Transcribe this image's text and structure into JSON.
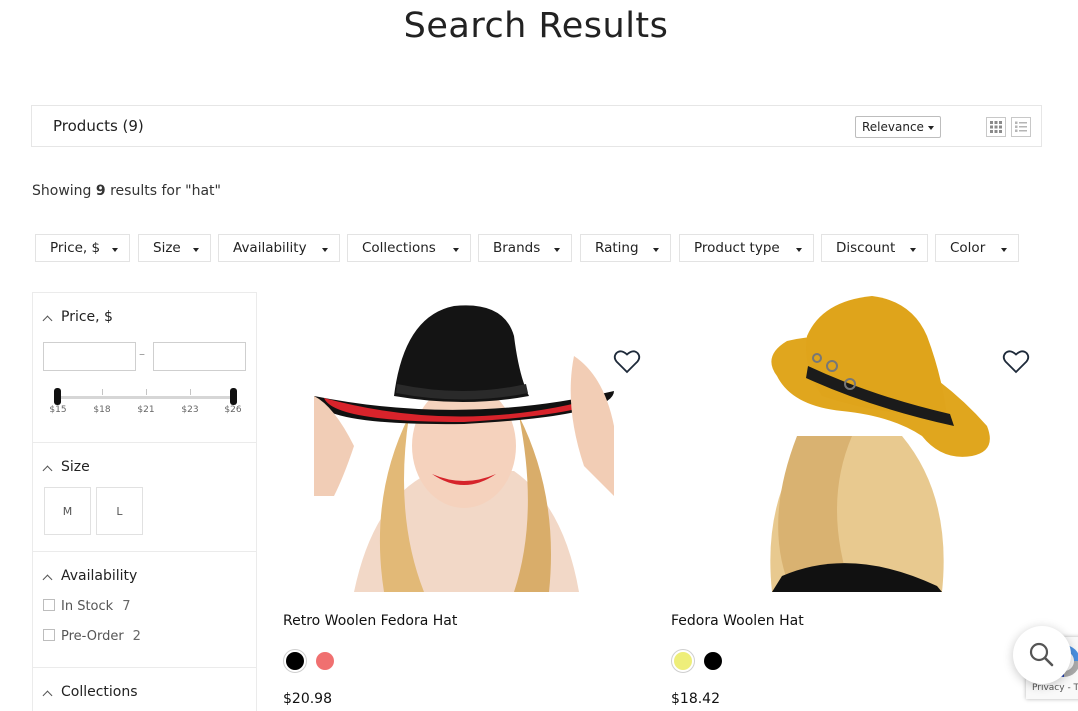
{
  "page": {
    "title": "Search Results"
  },
  "toolbar": {
    "products_label": "Products (9)",
    "sort": {
      "selected": "Relevance"
    },
    "views": [
      "grid-view-icon",
      "list-view-icon"
    ]
  },
  "summary": {
    "prefix": "Showing",
    "count": "9",
    "suffix": "results for \"hat\""
  },
  "filters": [
    {
      "label": "Price, $"
    },
    {
      "label": "Size"
    },
    {
      "label": "Availability"
    },
    {
      "label": "Collections"
    },
    {
      "label": "Brands"
    },
    {
      "label": "Rating"
    },
    {
      "label": "Product type"
    },
    {
      "label": "Discount"
    },
    {
      "label": "Color"
    }
  ],
  "sidebar": {
    "price": {
      "title": "Price, $",
      "min_value": "",
      "max_value": "",
      "dash": "–",
      "ticks": [
        "$15",
        "$18",
        "$21",
        "$23",
        "$26"
      ],
      "range": [
        15,
        26
      ],
      "selected_range": [
        15,
        26
      ]
    },
    "size": {
      "title": "Size",
      "options": [
        "M",
        "L"
      ]
    },
    "availability": {
      "title": "Availability",
      "options": [
        {
          "label": "In Stock",
          "count": "7"
        },
        {
          "label": "Pre-Order",
          "count": "2"
        }
      ]
    },
    "collections": {
      "title": "Collections"
    }
  },
  "products": [
    {
      "title": "Retro Woolen Fedora Hat",
      "price": "$20.98",
      "swatches": [
        "#000000",
        "#f07070"
      ],
      "selected_swatch": 0,
      "image_subject": "woman in black fedora with red brim underside"
    },
    {
      "title": "Fedora Woolen Hat",
      "price": "$18.42",
      "swatches": [
        "#eeee7a",
        "#000000"
      ],
      "selected_swatch": 0,
      "image_subject": "woman in mustard fedora seen from behind"
    }
  ],
  "widgets": {
    "search_icon": "search-icon",
    "recaptcha_text": "Privacy - Terms"
  }
}
